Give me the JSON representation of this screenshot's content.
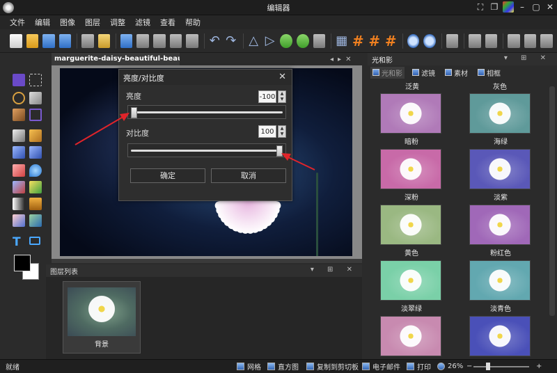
{
  "window": {
    "title": "编辑器"
  },
  "menu": [
    "文件",
    "编辑",
    "图像",
    "图层",
    "调整",
    "滤镜",
    "查看",
    "帮助"
  ],
  "document": {
    "tab_title": "marguerite-daisy-beautiful-beauty.jpg *"
  },
  "dialog": {
    "title": "亮度/对比度",
    "brightness_label": "亮度",
    "brightness_value": "-100",
    "brightness_level": -100,
    "contrast_label": "对比度",
    "contrast_value": "100",
    "contrast_level": 100,
    "ok_label": "确定",
    "cancel_label": "取消"
  },
  "layers_panel": {
    "title": "图层列表",
    "layers": [
      {
        "name": "背景"
      }
    ]
  },
  "right_panel": {
    "title": "光和影",
    "tabs": [
      {
        "label": "光和影",
        "active": true
      },
      {
        "label": "滤镜",
        "active": false
      },
      {
        "label": "素材",
        "active": false
      },
      {
        "label": "相框",
        "active": false
      }
    ],
    "top_labels": [
      "泛黄",
      "灰色"
    ],
    "filters": [
      {
        "label": "暗粉",
        "color": "#b07ab8"
      },
      {
        "label": "海绿",
        "color": "#5f9a9a"
      },
      {
        "label": "深粉",
        "color": "#c86aa8"
      },
      {
        "label": "淡紫",
        "color": "#5a58b8"
      },
      {
        "label": "黄色",
        "color": "#9ab882"
      },
      {
        "label": "粉红色",
        "color": "#a068b8"
      },
      {
        "label": "淡翠绿",
        "color": "#7ad0a8"
      },
      {
        "label": "淡青色",
        "color": "#62a8b0"
      },
      {
        "label": "",
        "color": "#c88ab0"
      },
      {
        "label": "",
        "color": "#4a50b8"
      }
    ]
  },
  "statusbar": {
    "ready": "就绪",
    "grid": "网格",
    "histogram": "直方图",
    "copy_clipboard": "复制到剪切板",
    "email": "电子邮件",
    "print": "打印",
    "zoom": "26%",
    "zoom_minus": "−",
    "zoom_plus": "+"
  },
  "colors": {
    "accent": "#4aa8ff",
    "annotation": "#e0242a"
  }
}
